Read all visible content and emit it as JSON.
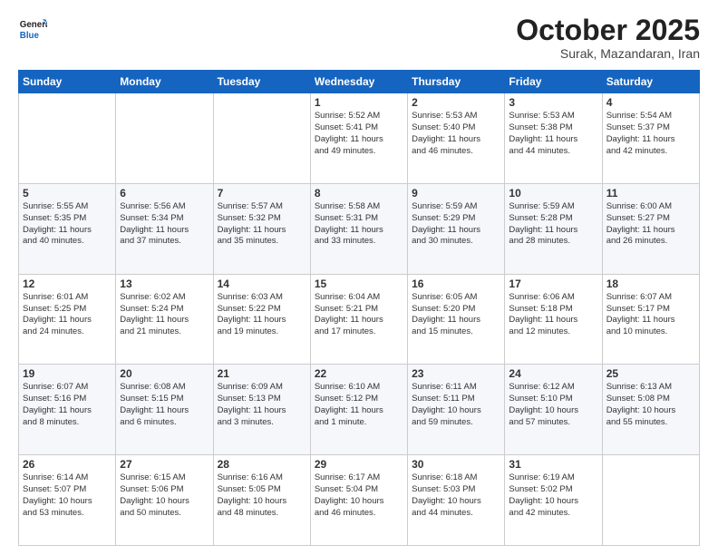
{
  "header": {
    "logo_line1": "General",
    "logo_line2": "Blue",
    "month": "October 2025",
    "location": "Surak, Mazandaran, Iran"
  },
  "weekdays": [
    "Sunday",
    "Monday",
    "Tuesday",
    "Wednesday",
    "Thursday",
    "Friday",
    "Saturday"
  ],
  "weeks": [
    [
      {
        "day": "",
        "info": ""
      },
      {
        "day": "",
        "info": ""
      },
      {
        "day": "",
        "info": ""
      },
      {
        "day": "1",
        "info": "Sunrise: 5:52 AM\nSunset: 5:41 PM\nDaylight: 11 hours\nand 49 minutes."
      },
      {
        "day": "2",
        "info": "Sunrise: 5:53 AM\nSunset: 5:40 PM\nDaylight: 11 hours\nand 46 minutes."
      },
      {
        "day": "3",
        "info": "Sunrise: 5:53 AM\nSunset: 5:38 PM\nDaylight: 11 hours\nand 44 minutes."
      },
      {
        "day": "4",
        "info": "Sunrise: 5:54 AM\nSunset: 5:37 PM\nDaylight: 11 hours\nand 42 minutes."
      }
    ],
    [
      {
        "day": "5",
        "info": "Sunrise: 5:55 AM\nSunset: 5:35 PM\nDaylight: 11 hours\nand 40 minutes."
      },
      {
        "day": "6",
        "info": "Sunrise: 5:56 AM\nSunset: 5:34 PM\nDaylight: 11 hours\nand 37 minutes."
      },
      {
        "day": "7",
        "info": "Sunrise: 5:57 AM\nSunset: 5:32 PM\nDaylight: 11 hours\nand 35 minutes."
      },
      {
        "day": "8",
        "info": "Sunrise: 5:58 AM\nSunset: 5:31 PM\nDaylight: 11 hours\nand 33 minutes."
      },
      {
        "day": "9",
        "info": "Sunrise: 5:59 AM\nSunset: 5:29 PM\nDaylight: 11 hours\nand 30 minutes."
      },
      {
        "day": "10",
        "info": "Sunrise: 5:59 AM\nSunset: 5:28 PM\nDaylight: 11 hours\nand 28 minutes."
      },
      {
        "day": "11",
        "info": "Sunrise: 6:00 AM\nSunset: 5:27 PM\nDaylight: 11 hours\nand 26 minutes."
      }
    ],
    [
      {
        "day": "12",
        "info": "Sunrise: 6:01 AM\nSunset: 5:25 PM\nDaylight: 11 hours\nand 24 minutes."
      },
      {
        "day": "13",
        "info": "Sunrise: 6:02 AM\nSunset: 5:24 PM\nDaylight: 11 hours\nand 21 minutes."
      },
      {
        "day": "14",
        "info": "Sunrise: 6:03 AM\nSunset: 5:22 PM\nDaylight: 11 hours\nand 19 minutes."
      },
      {
        "day": "15",
        "info": "Sunrise: 6:04 AM\nSunset: 5:21 PM\nDaylight: 11 hours\nand 17 minutes."
      },
      {
        "day": "16",
        "info": "Sunrise: 6:05 AM\nSunset: 5:20 PM\nDaylight: 11 hours\nand 15 minutes."
      },
      {
        "day": "17",
        "info": "Sunrise: 6:06 AM\nSunset: 5:18 PM\nDaylight: 11 hours\nand 12 minutes."
      },
      {
        "day": "18",
        "info": "Sunrise: 6:07 AM\nSunset: 5:17 PM\nDaylight: 11 hours\nand 10 minutes."
      }
    ],
    [
      {
        "day": "19",
        "info": "Sunrise: 6:07 AM\nSunset: 5:16 PM\nDaylight: 11 hours\nand 8 minutes."
      },
      {
        "day": "20",
        "info": "Sunrise: 6:08 AM\nSunset: 5:15 PM\nDaylight: 11 hours\nand 6 minutes."
      },
      {
        "day": "21",
        "info": "Sunrise: 6:09 AM\nSunset: 5:13 PM\nDaylight: 11 hours\nand 3 minutes."
      },
      {
        "day": "22",
        "info": "Sunrise: 6:10 AM\nSunset: 5:12 PM\nDaylight: 11 hours\nand 1 minute."
      },
      {
        "day": "23",
        "info": "Sunrise: 6:11 AM\nSunset: 5:11 PM\nDaylight: 10 hours\nand 59 minutes."
      },
      {
        "day": "24",
        "info": "Sunrise: 6:12 AM\nSunset: 5:10 PM\nDaylight: 10 hours\nand 57 minutes."
      },
      {
        "day": "25",
        "info": "Sunrise: 6:13 AM\nSunset: 5:08 PM\nDaylight: 10 hours\nand 55 minutes."
      }
    ],
    [
      {
        "day": "26",
        "info": "Sunrise: 6:14 AM\nSunset: 5:07 PM\nDaylight: 10 hours\nand 53 minutes."
      },
      {
        "day": "27",
        "info": "Sunrise: 6:15 AM\nSunset: 5:06 PM\nDaylight: 10 hours\nand 50 minutes."
      },
      {
        "day": "28",
        "info": "Sunrise: 6:16 AM\nSunset: 5:05 PM\nDaylight: 10 hours\nand 48 minutes."
      },
      {
        "day": "29",
        "info": "Sunrise: 6:17 AM\nSunset: 5:04 PM\nDaylight: 10 hours\nand 46 minutes."
      },
      {
        "day": "30",
        "info": "Sunrise: 6:18 AM\nSunset: 5:03 PM\nDaylight: 10 hours\nand 44 minutes."
      },
      {
        "day": "31",
        "info": "Sunrise: 6:19 AM\nSunset: 5:02 PM\nDaylight: 10 hours\nand 42 minutes."
      },
      {
        "day": "",
        "info": ""
      }
    ]
  ]
}
